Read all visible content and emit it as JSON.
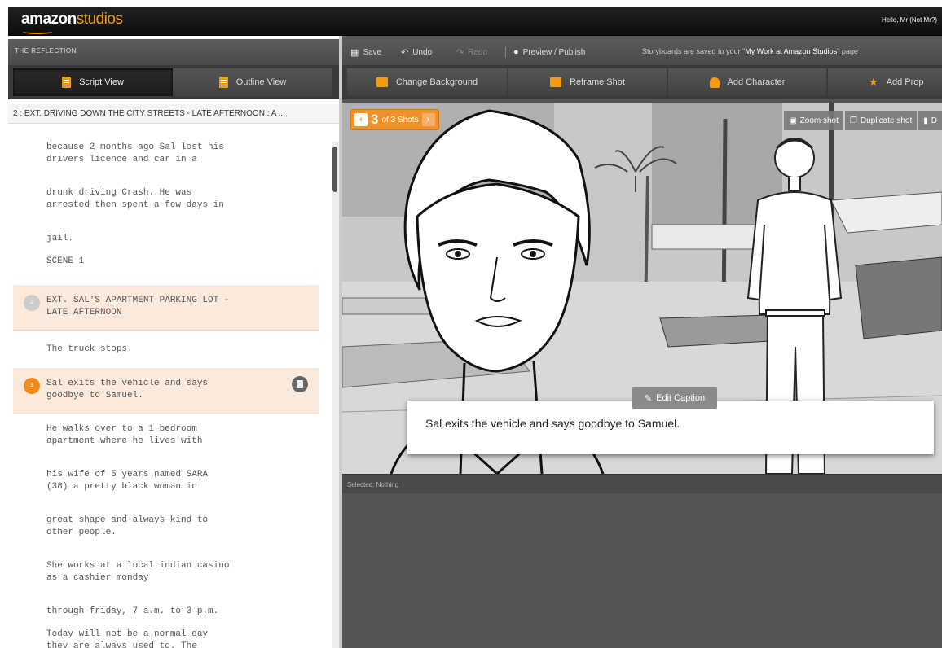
{
  "topbar": {
    "logo_amazon": "amazon",
    "logo_studios": "studios",
    "greeting": "Hello, Mr (Not Mr?)"
  },
  "left": {
    "project_title": "THE REFLECTION",
    "tabs": [
      {
        "label": "Script View",
        "icon": "document-icon",
        "active": true
      },
      {
        "label": "Outline View",
        "icon": "document-icon",
        "active": false
      }
    ],
    "scene_header": "2 : EXT. DRIVING DOWN THE CITY STREETS - LATE AFTERNOON : A ...",
    "script_lines": [
      {
        "text": "because 2 months ago Sal lost his\ndrivers licence and car in a"
      },
      {
        "text": "drunk driving Crash. He was\narrested then spent a few days in"
      },
      {
        "text": "jail."
      },
      {
        "text": "SCENE 1"
      },
      {
        "text": "EXT. SAL'S APARTMENT PARKING LOT -\nLATE AFTERNOON",
        "badge": "2",
        "highlight": true
      },
      {
        "text": "The truck stops."
      },
      {
        "text": "Sal exits the vehicle and says\ngoodbye to Samuel.",
        "badge": "3",
        "highlight": true,
        "selected": true
      },
      {
        "text": "He walks over to a 1 bedroom\napartment where he lives with"
      },
      {
        "text": "his wife of 5 years named SARA\n(38) a pretty black woman in"
      },
      {
        "text": "great shape and always kind to\nother people."
      },
      {
        "text": "She works at a local indian casino\nas a cashier monday"
      },
      {
        "text": "through friday, 7 a.m. to 3 p.m."
      },
      {
        "text": "Today will not be a normal day\nthey are always used to. The"
      }
    ]
  },
  "toolbar": {
    "save": "Save",
    "undo": "Undo",
    "redo": "Redo",
    "preview": "Preview / Publish",
    "storage_prefix": "Storyboards are saved to your \"",
    "storage_link": "My Work at Amazon Studios",
    "storage_suffix": "\" page"
  },
  "actions": [
    {
      "label": "Change Background",
      "icon": "background-icon"
    },
    {
      "label": "Reframe Shot",
      "icon": "frame-icon"
    },
    {
      "label": "Add Character",
      "icon": "person-icon"
    },
    {
      "label": "Add Prop",
      "icon": "star-icon"
    }
  ],
  "stage": {
    "shot_current": "3",
    "shot_of": "of 3 Shots",
    "tools": {
      "zoom": "Zoom shot",
      "duplicate": "Duplicate shot",
      "delete": "D"
    },
    "edit_caption": "Edit Caption",
    "caption": "Sal exits the vehicle and says goodbye to Samuel."
  },
  "selection_status": "Selected: Nothing",
  "colors": {
    "accent": "#f39c12",
    "highlight_row": "#fbe9dc",
    "toolbar_bg": "#4a4a4a"
  }
}
